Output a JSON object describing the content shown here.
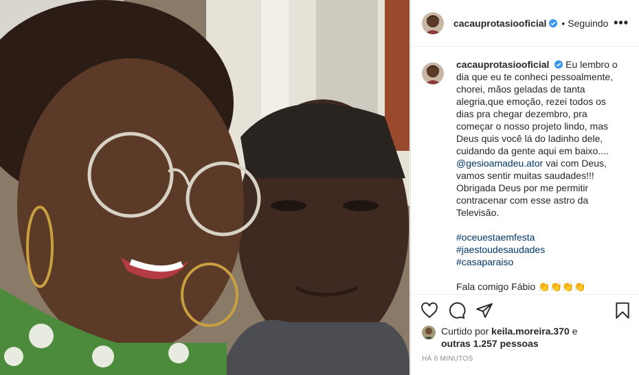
{
  "post": {
    "username": "cacauprotasiooficial",
    "dot": "•",
    "follow_status": "Seguindo",
    "more_icon": "•••"
  },
  "caption": {
    "username": "cacauprotasiooficial",
    "text_part1": "Eu lembro o dia que eu te conheci pessoalmente, chorei, mãos geladas de tanta alegria,que emoção, rezei todos os dias pra chegar dezembro, pra começar o nosso projeto lindo, mas Deus quis você lá do ladinho dele, cuidando da gente aqui em baixo....",
    "mention": "@gesioamadeu.ator",
    "text_part2": "vai com Deus, vamos sentir muitas saudades!!! Obrigada Deus por me permitir contracenar com esse astro da Televisão.",
    "hashtags": [
      "#oceuestaemfesta",
      "#jaestoudesaudades",
      "#casaparaiso"
    ],
    "cut_line": "Fala comigo Fábio 👏👏👏👏"
  },
  "likes": {
    "prefix": "Curtido por",
    "user": "keila.moreira.370",
    "conj": "e",
    "others": "outras 1.257 pessoas"
  },
  "timestamp": "HÁ 6 MINUTOS",
  "colors": {
    "link": "#00376b",
    "verified": "#3897f0",
    "text": "#262626",
    "muted": "#8e8e8e"
  }
}
